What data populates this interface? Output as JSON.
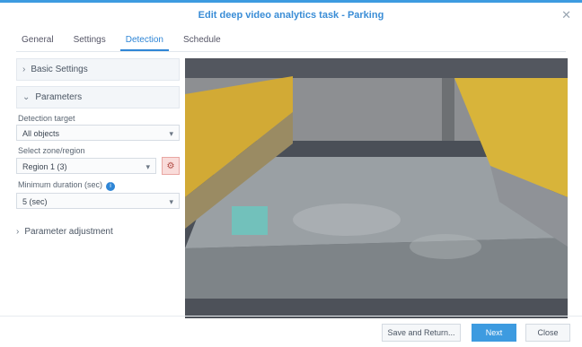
{
  "window": {
    "title": "Edit deep video analytics task - Parking",
    "close_icon": "close-icon"
  },
  "tabs": [
    "General",
    "Settings",
    "Detection",
    "Schedule"
  ],
  "sidebar": {
    "sections": [
      {
        "label": "Basic Settings"
      },
      {
        "label": "Parameters"
      }
    ],
    "fields": [
      {
        "label": "Detection target",
        "value": "All objects"
      },
      {
        "label": "Select zone/region",
        "value": "Region 1 (3)"
      },
      {
        "label": "Minimum duration (sec)",
        "value": "5 (sec)"
      }
    ],
    "advanced_label": "Parameter adjustment"
  },
  "footer": {
    "apply_label": "Save and Return...",
    "next_label": "Next",
    "close_label": "Close"
  },
  "colors": {
    "accent": "#3d9be0",
    "danger": "#e9a7a3"
  }
}
